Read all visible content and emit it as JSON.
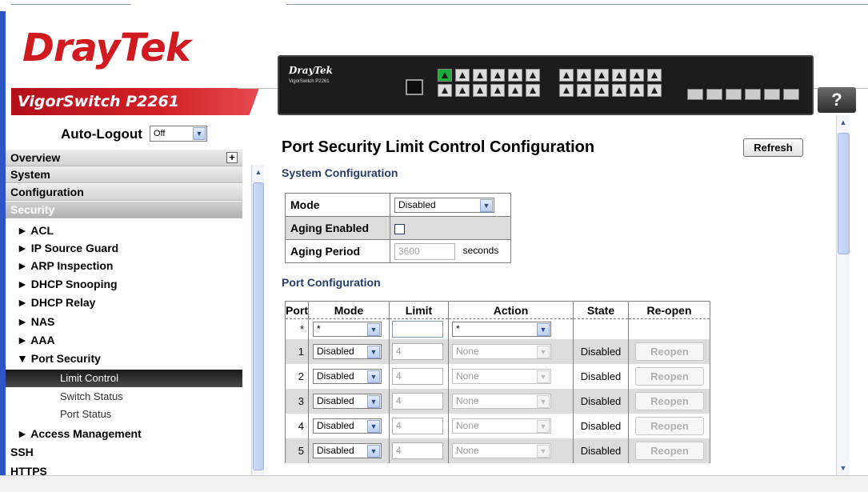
{
  "header": {
    "logo": "DrayTek",
    "model": "VigorSwitch P2261",
    "device_brand": "DrayTek",
    "device_model": "VigorSwitch P2261",
    "help_label": "?"
  },
  "nav": {
    "auto_logout_label": "Auto-Logout",
    "auto_logout_value": "Off",
    "sections": [
      "Overview",
      "System",
      "Configuration",
      "Security"
    ],
    "items": [
      "ACL",
      "IP Source Guard",
      "ARP Inspection",
      "DHCP Snooping",
      "DHCP Relay",
      "NAS",
      "AAA",
      "Port Security"
    ],
    "port_security_sub": [
      "Limit Control",
      "Switch Status",
      "Port Status"
    ],
    "after": [
      "Access Management"
    ],
    "plain": [
      "SSH",
      "HTTPS"
    ],
    "collapsed_marker": "►",
    "expanded_marker": "▼"
  },
  "main": {
    "title": "Port Security Limit Control Configuration",
    "refresh_label": "Refresh",
    "system_heading": "System Configuration",
    "system": {
      "mode_label": "Mode",
      "mode_value": "Disabled",
      "aging_enabled_label": "Aging Enabled",
      "aging_period_label": "Aging Period",
      "aging_period_value": "3600",
      "aging_unit": "seconds"
    },
    "port_heading": "Port Configuration",
    "columns": [
      "Port",
      "Mode",
      "Limit",
      "Action",
      "State",
      "Re-open"
    ],
    "star_row": {
      "port": "*",
      "mode": "*",
      "action": "*"
    },
    "rows": [
      {
        "port": "1",
        "mode": "Disabled",
        "limit": "4",
        "action": "None",
        "state": "Disabled",
        "reopen": "Reopen"
      },
      {
        "port": "2",
        "mode": "Disabled",
        "limit": "4",
        "action": "None",
        "state": "Disabled",
        "reopen": "Reopen"
      },
      {
        "port": "3",
        "mode": "Disabled",
        "limit": "4",
        "action": "None",
        "state": "Disabled",
        "reopen": "Reopen"
      },
      {
        "port": "4",
        "mode": "Disabled",
        "limit": "4",
        "action": "None",
        "state": "Disabled",
        "reopen": "Reopen"
      },
      {
        "port": "5",
        "mode": "Disabled",
        "limit": "4",
        "action": "None",
        "state": "Disabled",
        "reopen": "Reopen"
      }
    ]
  },
  "colors": {
    "brand_red": "#d11a1f",
    "heading_blue": "#243b6b",
    "row_grey": "#dcdcdc",
    "nav_active": "#1a1a1a"
  }
}
